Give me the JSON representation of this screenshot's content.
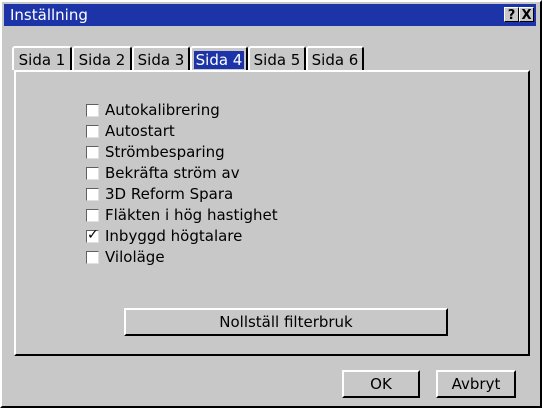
{
  "window": {
    "title": "Inställning",
    "help_glyph": "?",
    "close_glyph": "X"
  },
  "tabs": [
    {
      "label": "Sida 1",
      "active": false
    },
    {
      "label": "Sida 2",
      "active": false
    },
    {
      "label": "Sida 3",
      "active": false
    },
    {
      "label": "Sida 4",
      "active": true
    },
    {
      "label": "Sida 5",
      "active": false
    },
    {
      "label": "Sida 6",
      "active": false
    }
  ],
  "options": [
    {
      "label": "Autokalibrering",
      "checked": false
    },
    {
      "label": "Autostart",
      "checked": false
    },
    {
      "label": "Strömbesparing",
      "checked": false
    },
    {
      "label": "Bekräfta ström av",
      "checked": false
    },
    {
      "label": "3D Reform Spara",
      "checked": false
    },
    {
      "label": "Fläkten i hög hastighet",
      "checked": false
    },
    {
      "label": "Inbyggd högtalare",
      "checked": true
    },
    {
      "label": "Viloläge",
      "checked": false
    }
  ],
  "check_glyph": "✓",
  "buttons": {
    "reset_filter": "Nollställ filterbruk",
    "ok": "OK",
    "cancel": "Avbryt"
  },
  "colors": {
    "titlebar": "#1c34a8",
    "face": "#c8c8c8",
    "selected_tab": "#1c34a8"
  }
}
